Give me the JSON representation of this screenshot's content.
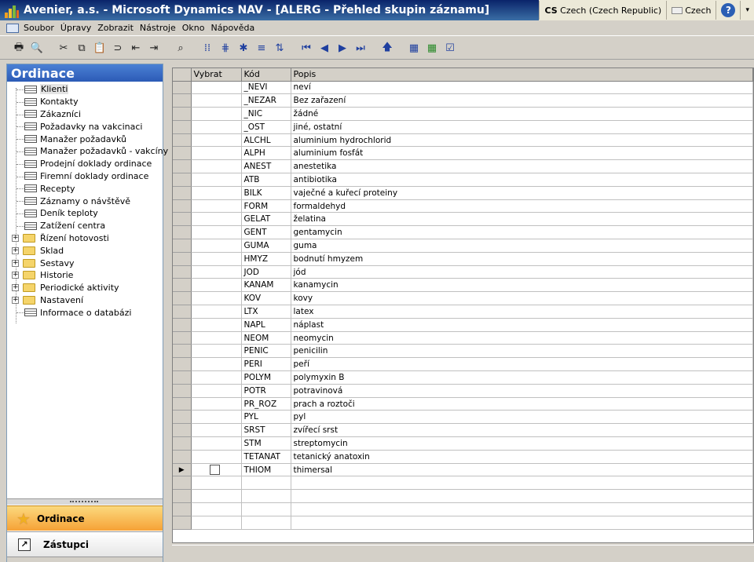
{
  "window": {
    "title": "Avenier, a.s. - Microsoft Dynamics NAV - [ALERG - Přehled skupin záznamu]",
    "language_code": "CS",
    "language": "Czech (Czech Republic)",
    "keyboard": "Czech"
  },
  "menu": [
    "Soubor",
    "Úpravy",
    "Zobrazit",
    "Nástroje",
    "Okno",
    "Nápověda"
  ],
  "toolbar": {
    "icons": [
      "print-icon",
      "print-preview-icon",
      "cut-icon",
      "copy-icon",
      "paste-icon",
      "attach-icon",
      "arrow-left-icon",
      "arrow-right-icon",
      "find-icon",
      "filter-icon",
      "field-filter-icon",
      "flowfilter-icon",
      "show-all-icon",
      "sort-icon",
      "first-record-icon",
      "previous-record-icon",
      "next-record-icon",
      "last-record-icon",
      "up-icon",
      "form-icon",
      "table-icon",
      "list-icon"
    ]
  },
  "nav": {
    "header": "Ordinace",
    "items": [
      {
        "label": "Klienti",
        "type": "form",
        "selected": true
      },
      {
        "label": "Kontakty",
        "type": "form"
      },
      {
        "label": "Zákazníci",
        "type": "form"
      },
      {
        "label": "Požadavky na vakcinaci",
        "type": "form"
      },
      {
        "label": "Manažer požadavků",
        "type": "form"
      },
      {
        "label": "Manažer požadavků - vakcíny",
        "type": "form"
      },
      {
        "label": "Prodejní doklady ordinace",
        "type": "form"
      },
      {
        "label": "Firemní doklady ordinace",
        "type": "form"
      },
      {
        "label": "Recepty",
        "type": "form"
      },
      {
        "label": "Záznamy o návštěvě",
        "type": "form"
      },
      {
        "label": "Deník teploty",
        "type": "form"
      },
      {
        "label": "Zatížení centra",
        "type": "form"
      },
      {
        "label": "Řízení hotovosti",
        "type": "folder"
      },
      {
        "label": "Sklad",
        "type": "folder"
      },
      {
        "label": "Sestavy",
        "type": "folder"
      },
      {
        "label": "Historie",
        "type": "folder"
      },
      {
        "label": "Periodické aktivity",
        "type": "folder"
      },
      {
        "label": "Nastavení",
        "type": "folder"
      },
      {
        "label": "Informace o databázi",
        "type": "form"
      }
    ],
    "buttons": {
      "active": "Ordinace",
      "other": "Zástupci"
    }
  },
  "grid": {
    "columns": [
      "Vybrat",
      "Kód",
      "Popis"
    ],
    "rows": [
      {
        "code": "_NEVI",
        "desc": "neví"
      },
      {
        "code": "_NEZAR",
        "desc": "Bez zařazení"
      },
      {
        "code": "_NIC",
        "desc": "žádné"
      },
      {
        "code": "_OST",
        "desc": "jiné, ostatní"
      },
      {
        "code": "ALCHL",
        "desc": "aluminium hydrochlorid"
      },
      {
        "code": "ALPH",
        "desc": "aluminium fosfát"
      },
      {
        "code": "ANEST",
        "desc": "anestetika"
      },
      {
        "code": "ATB",
        "desc": "antibiotika"
      },
      {
        "code": "BILK",
        "desc": "vaječné a kuřecí proteiny"
      },
      {
        "code": "FORM",
        "desc": "formaldehyd"
      },
      {
        "code": "GELAT",
        "desc": "želatina"
      },
      {
        "code": "GENT",
        "desc": "gentamycin"
      },
      {
        "code": "GUMA",
        "desc": "guma"
      },
      {
        "code": "HMYZ",
        "desc": "bodnutí hmyzem"
      },
      {
        "code": "JOD",
        "desc": "jód"
      },
      {
        "code": "KANAM",
        "desc": "kanamycin"
      },
      {
        "code": "KOV",
        "desc": "kovy"
      },
      {
        "code": "LTX",
        "desc": "latex"
      },
      {
        "code": "NAPL",
        "desc": "náplast"
      },
      {
        "code": "NEOM",
        "desc": "neomycin"
      },
      {
        "code": "PENIC",
        "desc": "penicilin"
      },
      {
        "code": "PERI",
        "desc": "peří"
      },
      {
        "code": "POLYM",
        "desc": "polymyxin B"
      },
      {
        "code": "POTR",
        "desc": "potravinová"
      },
      {
        "code": "PR_ROZ",
        "desc": "prach a roztoči"
      },
      {
        "code": "PYL",
        "desc": "pyl"
      },
      {
        "code": "SRST",
        "desc": "zvířecí srst"
      },
      {
        "code": "STM",
        "desc": "streptomycin"
      },
      {
        "code": "TETANAT",
        "desc": "tetanický anatoxin"
      },
      {
        "code": "THIOM",
        "desc": "thimersal",
        "current": true,
        "checkbox": true
      }
    ]
  }
}
